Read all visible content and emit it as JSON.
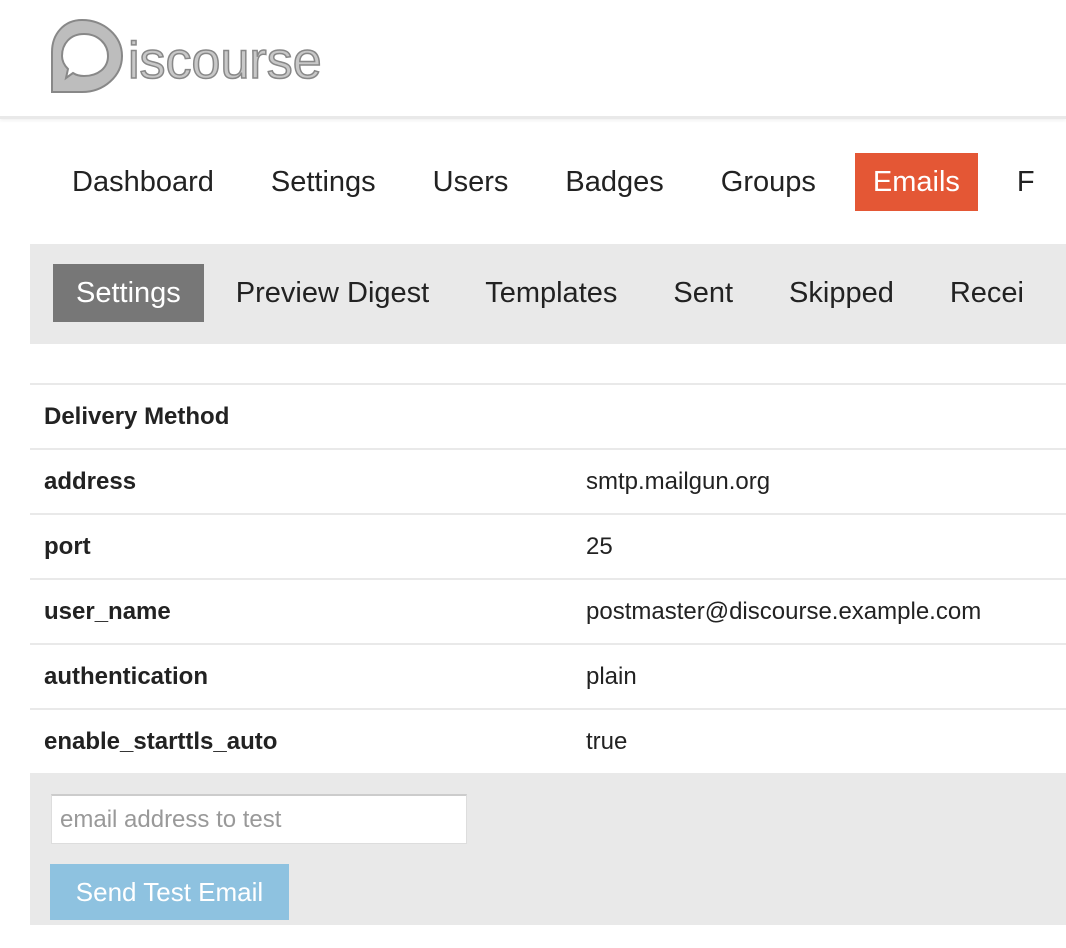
{
  "header": {
    "logo_text": "Discourse"
  },
  "nav": {
    "items": [
      {
        "label": "Dashboard",
        "active": false
      },
      {
        "label": "Settings",
        "active": false
      },
      {
        "label": "Users",
        "active": false
      },
      {
        "label": "Badges",
        "active": false
      },
      {
        "label": "Groups",
        "active": false
      },
      {
        "label": "Emails",
        "active": true
      },
      {
        "label": "F",
        "active": false
      }
    ]
  },
  "subnav": {
    "items": [
      {
        "label": "Settings",
        "active": true
      },
      {
        "label": "Preview Digest",
        "active": false
      },
      {
        "label": "Templates",
        "active": false
      },
      {
        "label": "Sent",
        "active": false
      },
      {
        "label": "Skipped",
        "active": false
      },
      {
        "label": "Recei",
        "active": false
      }
    ]
  },
  "settings": {
    "section_title": "Delivery Method",
    "rows": [
      {
        "key": "address",
        "value": "smtp.mailgun.org"
      },
      {
        "key": "port",
        "value": "25"
      },
      {
        "key": "user_name",
        "value": "postmaster@discourse.example.com"
      },
      {
        "key": "authentication",
        "value": "plain"
      },
      {
        "key": "enable_starttls_auto",
        "value": "true"
      }
    ]
  },
  "test_email": {
    "placeholder": "email address to test",
    "value": "",
    "button_label": "Send Test Email"
  },
  "colors": {
    "accent": "#e45735",
    "subnav_active": "#777777",
    "button_disabled": "#8ec2e0",
    "panel_bg": "#e9e9e9"
  }
}
